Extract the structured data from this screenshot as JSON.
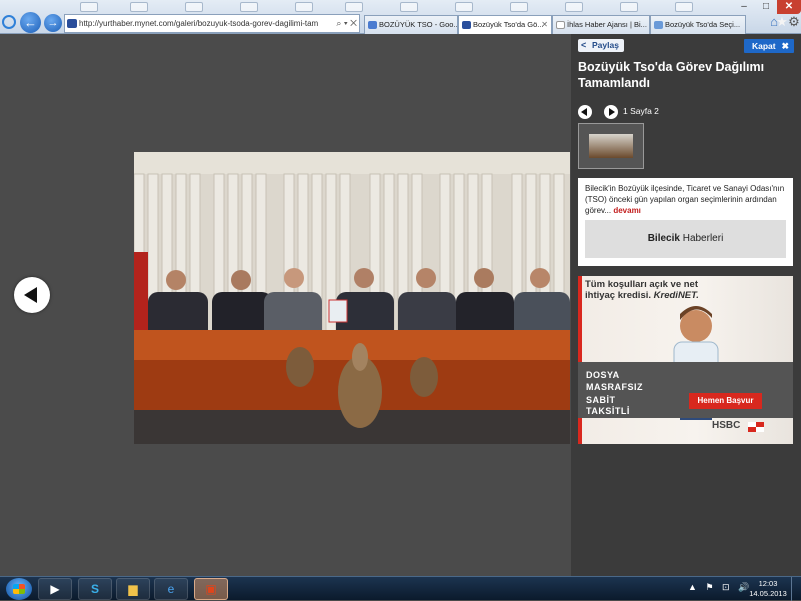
{
  "browser": {
    "url": "http://yurthaber.mynet.com/galeri/bozuyuk-tsoda-gorev-dagilimi-tam",
    "tabs": [
      {
        "label": "BOZÜYÜK TSO - Goo...",
        "active": false
      },
      {
        "label": "Bozüyük Tso'da Gö...",
        "active": true
      },
      {
        "label": "İhlas Haber Ajansı | Bi...",
        "active": false
      },
      {
        "label": "Bozüyük Tso'da Seçi...",
        "active": false
      }
    ],
    "window_controls": {
      "minimize": "–",
      "maximize": "□",
      "close": "✕"
    },
    "addr_controls": "⌕ ▾ ✕"
  },
  "gallery": {
    "prev_icon": "arrow-left-icon"
  },
  "panel": {
    "share_label": "Paylaş",
    "close_label": "Kapat",
    "title": "Bozüyük Tso'da Görev Dağılımı Tamamlandı",
    "page_label": "1 Sayfa 2",
    "description": "Bilecik'in Bozüyük ilçesinde, Ticaret ve Sanayi Odası'nın (TSO) önceki gün yapılan organ seçimlerinin ardından görev...",
    "more_label": "devamı",
    "category_bold": "Bilecik",
    "category_rest": " Haberleri"
  },
  "ad": {
    "headline_1": "Tüm koşulları açık ve net",
    "headline_2": "ihtiyaç kredisi.",
    "brand": "KrediNET.",
    "line_1": "DOSYA",
    "line_2": "MASRAFSIZ",
    "line_3": "SABİT",
    "line_4": "TAKSİTLİ",
    "cta": "Hemen Başvur",
    "logo": "HSBC"
  },
  "taskbar": {
    "time": "12:03",
    "date": "14.05.2013",
    "tray_arrow": "▲"
  },
  "colors": {
    "panel_bg": "#3b3b3b",
    "stage_bg": "#4b4b4b",
    "accent_blue": "#1e68c8",
    "link_red": "#c21d1d",
    "ad_red": "#d8281e"
  }
}
